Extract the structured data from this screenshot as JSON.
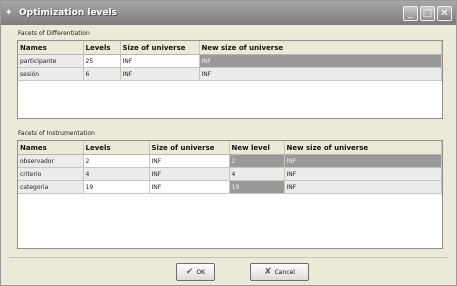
{
  "window": {
    "title": "Optimization levels"
  },
  "differentiation": {
    "label": "Facets of Differentiation",
    "headers": [
      "Names",
      "Levels",
      "Size of universe",
      "New size of universe"
    ],
    "rows": [
      {
        "name": "participante",
        "levels": "25",
        "size": "INF",
        "new_size": "INF"
      },
      {
        "name": "sesión",
        "levels": "6",
        "size": "INF",
        "new_size": "INF"
      }
    ]
  },
  "instrumentation": {
    "label": "Facets of Instrumentation",
    "headers": [
      "Names",
      "Levels",
      "Size of universe",
      "New level",
      "New size of universe"
    ],
    "rows": [
      {
        "name": "observador",
        "levels": "2",
        "size": "INF",
        "new_level": "2",
        "new_size": "INF"
      },
      {
        "name": "criterio",
        "levels": "4",
        "size": "INF",
        "new_level": "4",
        "new_size": "INF"
      },
      {
        "name": "categoria",
        "levels": "19",
        "size": "INF",
        "new_level": "19",
        "new_size": "INF"
      }
    ]
  },
  "buttons": {
    "ok": "OK",
    "cancel": "Cancel"
  },
  "icons": {
    "ok": "check-icon",
    "cancel": "x-icon"
  }
}
